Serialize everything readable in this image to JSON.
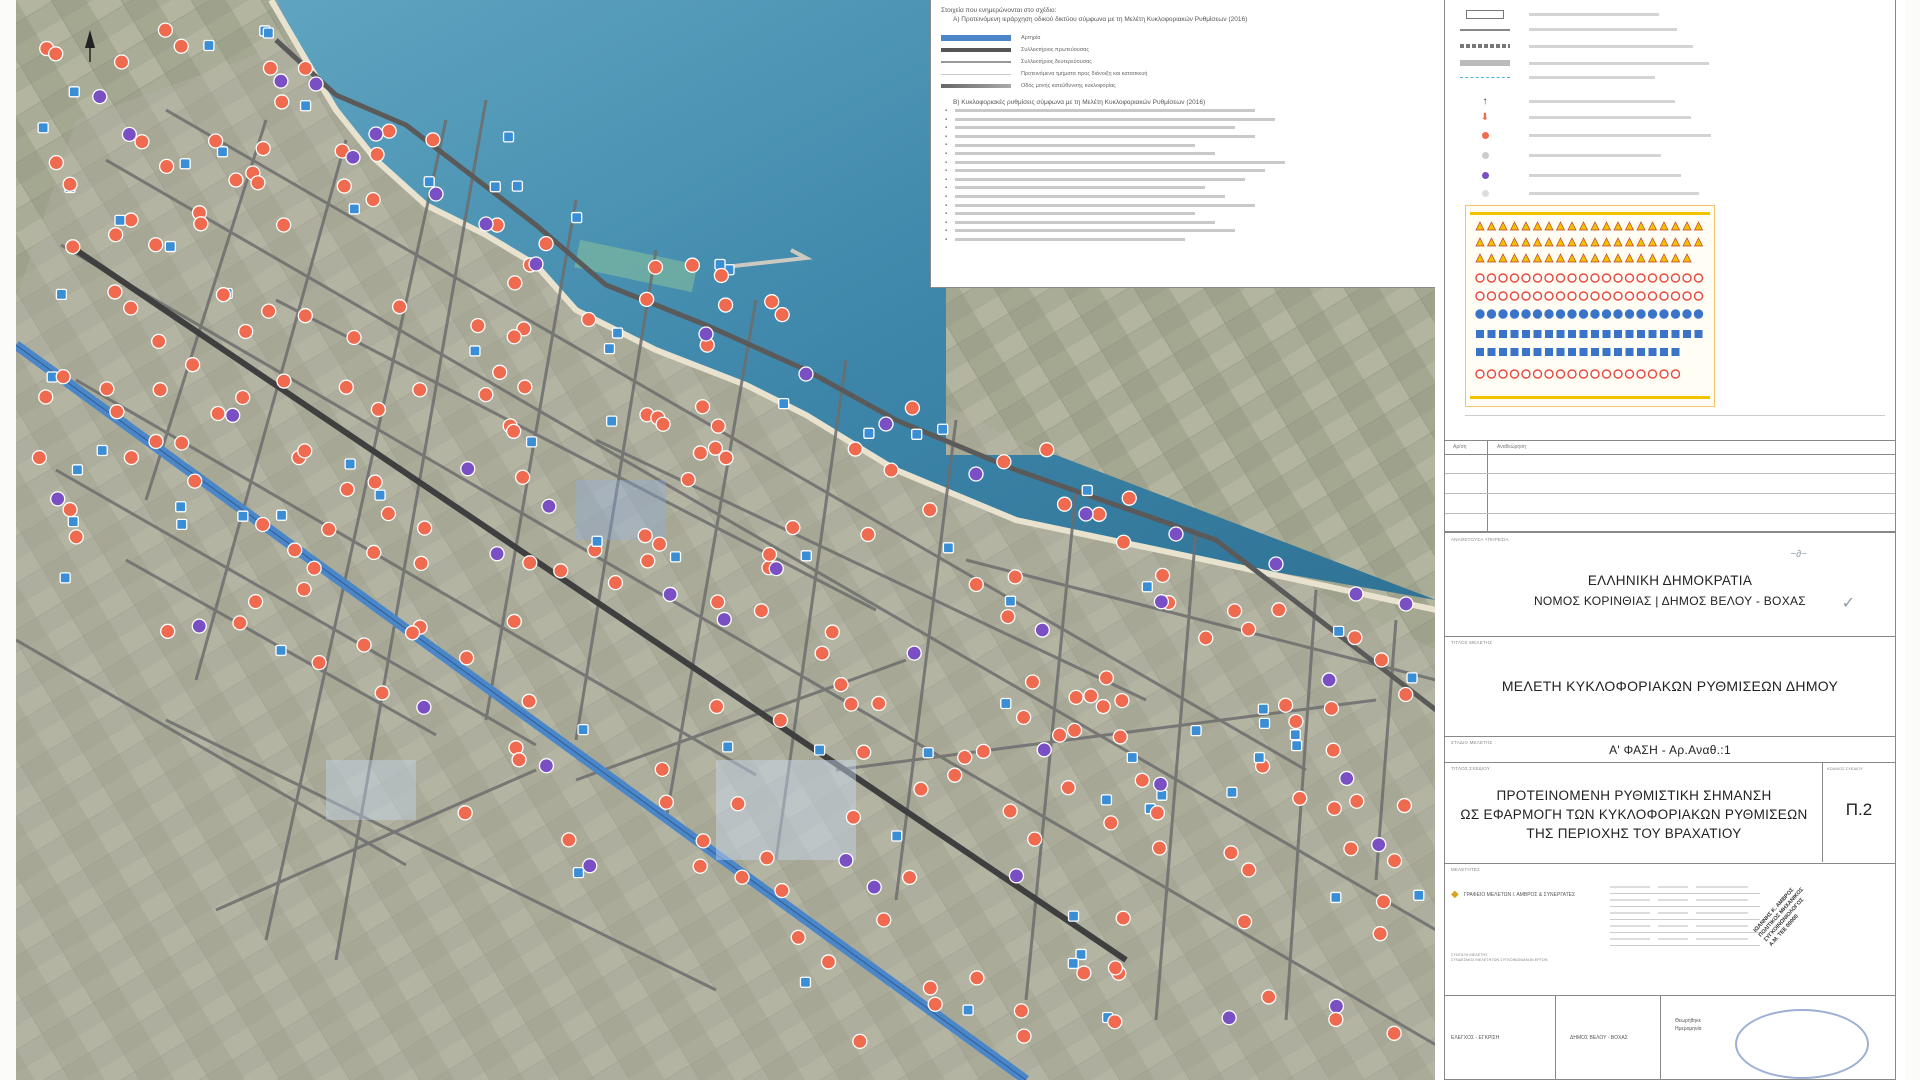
{
  "title_block": {
    "republic": "ΕΛΛΗΝΙΚΗ ΔΗΜΟΚΡΑΤΙΑ",
    "authority": "ΝΟΜΟΣ ΚΟΡΙΝΘΙΑΣ | ΔΗΜΟΣ ΒΕΛΟΥ - ΒΟΧΑΣ",
    "study_title": "ΜΕΛΕΤΗ ΚΥΚΛΟΦΟΡΙΑΚΩΝ ΡΥΘΜΙΣΕΩΝ ΔΗΜΟΥ",
    "phase": "Α' ΦΑΣΗ - Αρ.Αναθ.:1",
    "drawing_title_1": "ΠΡΟΤΕΙΝΟΜΕΝΗ ΡΥΘΜΙΣΤΙΚΗ ΣΗΜΑΝΣΗ",
    "drawing_title_2": "ΩΣ ΕΦΑΡΜΟΓΗ ΤΩΝ ΚΥΚΛΟΦΟΡΙΑΚΩΝ ΡΥΘΜΙΣΕΩΝ",
    "drawing_title_3": "ΤΗΣ ΠΕΡΙΟΧΗΣ ΤΟΥ ΒΡΑΧΑΤΙΟΥ",
    "drawing_code": "Π.2",
    "bottom_left": "ΕΛΕΓΧΟΣ - ΕΓΚΡΙΣΗ",
    "bottom_mid": "ΔΗΜΟΣ ΒΕΛΟΥ - ΒΟΧΑΣ",
    "firm": "ΓΡΑΦΕΙΟ ΜΕΛΕΤΩΝ Ι. ΑΜΒΡΟΣ & ΣΥΝΕΡΓΑΤΕΣ"
  },
  "revision_header": [
    "Αρ/ση",
    "Αναθεώρηση"
  ],
  "colors": {
    "sea": "#3f8fb3",
    "main_road": "#4a86c8",
    "highway": "#4c4c4c",
    "red_sign": "#ef6a4e",
    "blue_sign": "#3a8ed6",
    "purple_sign": "#7a4fc4"
  }
}
